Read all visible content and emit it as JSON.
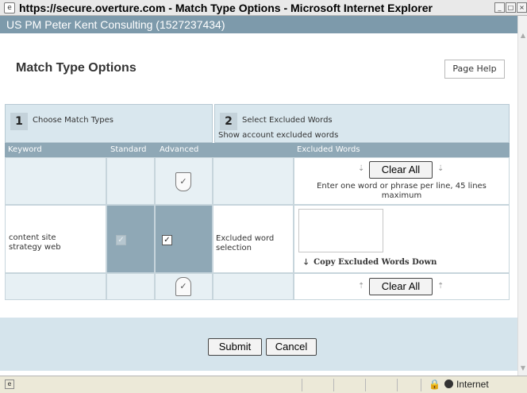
{
  "window": {
    "title": "https://secure.overture.com - Match Type Options - Microsoft Internet Explorer",
    "status_zone": "Internet"
  },
  "account": {
    "label": "US PM Peter Kent Consulting (1527237434)"
  },
  "page": {
    "title": "Match Type Options",
    "help_label": "Page Help"
  },
  "steps": [
    {
      "number": "1",
      "label": "Choose Match Types"
    },
    {
      "number": "2",
      "label": "Select Excluded Words",
      "sublink": "Show account excluded words"
    }
  ],
  "table": {
    "headers": {
      "keyword": "Keyword",
      "standard": "Standard",
      "advanced": "Advanced",
      "excluded": "Excluded Words"
    },
    "clear_all_label": "Clear All",
    "hint": "Enter one word or phrase per line, 45 lines maximum",
    "rows": [
      {
        "keyword": "content site strategy web",
        "standard_checked": true,
        "advanced_checked": true,
        "excluded_label": "Excluded word selection",
        "excluded_value": ""
      }
    ],
    "copy_down_label": "Copy Excluded Words Down"
  },
  "actions": {
    "submit_label": "Submit",
    "cancel_label": "Cancel"
  },
  "icons": {
    "shield_top": "check-shield-icon",
    "shield_bottom": "check-shield-icon"
  },
  "colors": {
    "account_bar": "#7d9aab",
    "step_bg": "#d9e7ee",
    "header_bg": "#8fa8b6"
  }
}
